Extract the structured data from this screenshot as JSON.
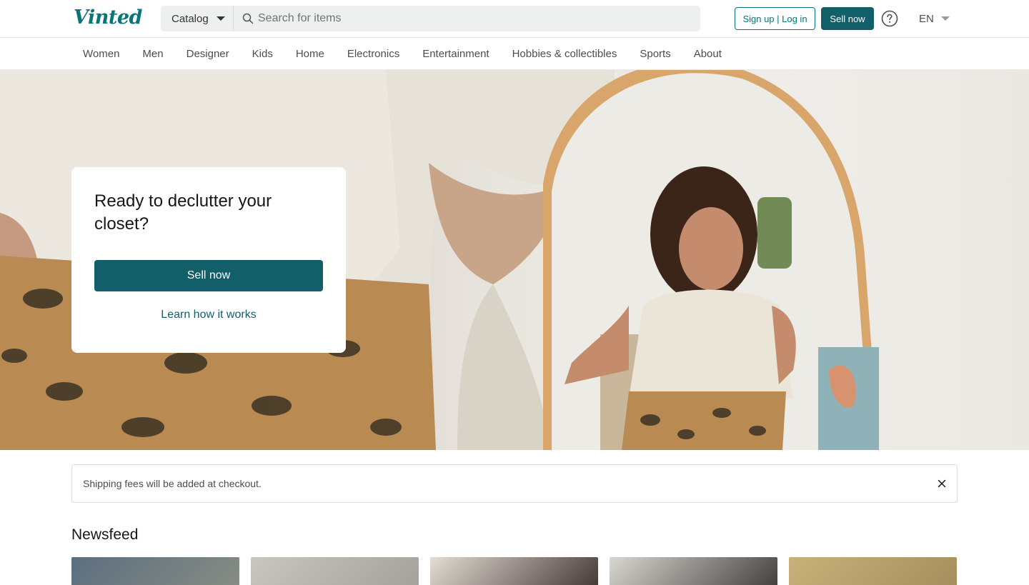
{
  "header": {
    "logo": "Vinted",
    "catalog_label": "Catalog",
    "search_placeholder": "Search for items",
    "signup_label": "Sign up | Log in",
    "sell_label": "Sell now",
    "help_icon": "question-circle-icon",
    "language": "EN"
  },
  "nav": {
    "categories": [
      "Women",
      "Men",
      "Designer",
      "Kids",
      "Home",
      "Electronics",
      "Entertainment",
      "Hobbies & collectibles",
      "Sports",
      "About"
    ]
  },
  "hero": {
    "title": "Ready to declutter your closet?",
    "sell_button": "Sell now",
    "learn_link": "Learn how it works"
  },
  "notice": {
    "text": "Shipping fees will be added at checkout.",
    "close_icon": "close-icon"
  },
  "newsfeed": {
    "title": "Newsfeed",
    "items": [
      {
        "colors": [
          "#5c6e7f",
          "#8a8e84"
        ]
      },
      {
        "colors": [
          "#c9c6bf",
          "#a29f98"
        ]
      },
      {
        "colors": [
          "#e3ddd5",
          "#3a2f2b"
        ]
      },
      {
        "colors": [
          "#d9d7d1",
          "#393534"
        ]
      },
      {
        "colors": [
          "#c9b17a",
          "#a38c5c"
        ]
      }
    ]
  },
  "theme": {
    "brand": "#09757a",
    "brand_dark": "#125f69"
  }
}
